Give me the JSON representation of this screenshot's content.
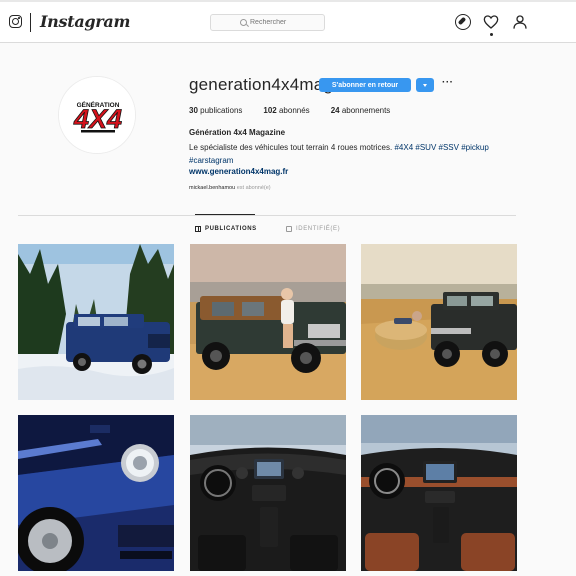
{
  "app": {
    "wordmark": "Instagram"
  },
  "search": {
    "placeholder": "Rechercher"
  },
  "icons": {
    "logo": "instagram-camera-icon",
    "explore": "compass-icon",
    "activity": "heart-icon",
    "profile": "person-icon",
    "search": "search-icon"
  },
  "colors": {
    "accent": "#3897f0",
    "link": "#003569",
    "muted": "#999999",
    "border": "#dbdbdb"
  },
  "profile": {
    "username": "generation4x4mag",
    "follow_back_label": "S'abonner en retour",
    "more_label": "···",
    "stats": {
      "posts_count": "30",
      "posts_label": "publications",
      "followers_count": "102",
      "followers_label": "abonnés",
      "following_count": "24",
      "following_label": "abonnements"
    },
    "full_name": "Génération 4x4 Magazine",
    "bio_text": "Le spécialiste des véhicules tout terrain 4 roues motrices.",
    "bio_hashtags": [
      "#4X4",
      "#SUV",
      "#SSV",
      "#pickup",
      "#carstagram"
    ],
    "website": "www.generation4x4mag.fr",
    "followed_by_user": "mickael.benhamou",
    "followed_by_suffix": "est abonné(e)",
    "avatar_logo_top": "GÉNÉRATION",
    "avatar_logo_main": "4X4"
  },
  "tabs": [
    {
      "label": "PUBLICATIONS",
      "active": true
    },
    {
      "label": "IDENTIFIÉ(E)",
      "active": false
    }
  ],
  "posts": [
    {
      "subject": "blue-suv-in-snow-photo"
    },
    {
      "subject": "brown-jeep-with-woman-photo"
    },
    {
      "subject": "black-jeep-hay-field-photo"
    },
    {
      "subject": "blue-suv-headlight-closeup-photo"
    },
    {
      "subject": "jeep-dashboard-interior-photo"
    },
    {
      "subject": "suv-brown-leather-interior-photo"
    }
  ]
}
